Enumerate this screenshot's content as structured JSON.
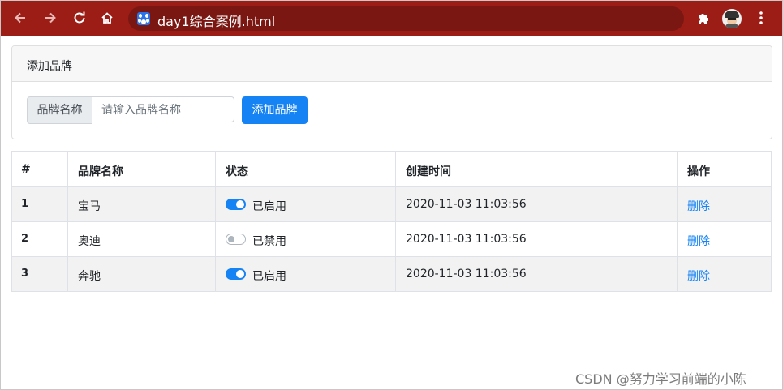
{
  "browser": {
    "url_title": "day1综合案例.html",
    "back_icon": "arrow-left-icon",
    "forward_icon": "arrow-right-icon",
    "reload_icon": "reload-icon",
    "home_icon": "home-icon",
    "extensions_icon": "puzzle-icon",
    "menu_icon": "kebab-menu-icon",
    "accent": "#9b1d16"
  },
  "card": {
    "title": "添加品牌",
    "input_label": "品牌名称",
    "input_placeholder": "请输入品牌名称",
    "input_value": "",
    "button_label": "添加品牌"
  },
  "table": {
    "headers": [
      "#",
      "品牌名称",
      "状态",
      "创建时间",
      "操作"
    ],
    "rows": [
      {
        "index": "1",
        "name": "宝马",
        "enabled": true,
        "status": "已启用",
        "created": "2020-11-03 11:03:56",
        "action": "删除"
      },
      {
        "index": "2",
        "name": "奥迪",
        "enabled": false,
        "status": "已禁用",
        "created": "2020-11-03 11:03:56",
        "action": "删除"
      },
      {
        "index": "3",
        "name": "奔驰",
        "enabled": true,
        "status": "已启用",
        "created": "2020-11-03 11:03:56",
        "action": "删除"
      }
    ]
  },
  "watermark": "CSDN @努力学习前端的小陈",
  "colors": {
    "primary": "#1683f5",
    "stripe": "#f2f2f2"
  }
}
